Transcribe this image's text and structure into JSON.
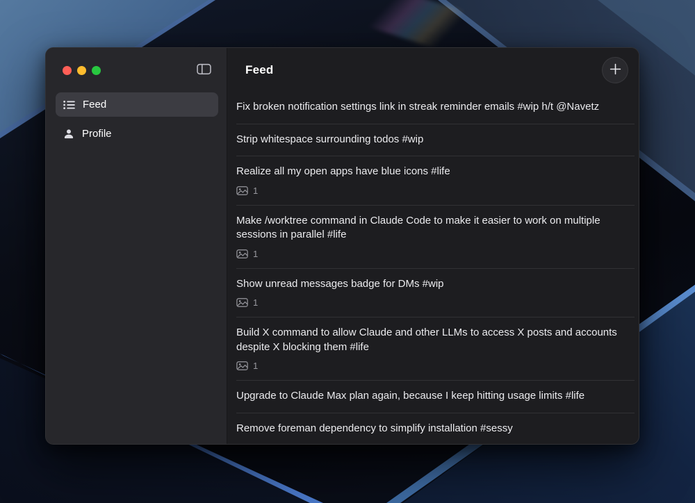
{
  "window": {
    "traffic_lights": {
      "close_color": "#ff5f57",
      "minimize_color": "#febc2e",
      "zoom_color": "#28c840"
    },
    "sidebar": {
      "toggle_icon": "sidebar-toggle-icon",
      "items": [
        {
          "label": "Feed",
          "icon": "list-bullet-icon",
          "selected": true
        },
        {
          "label": "Profile",
          "icon": "person-icon",
          "selected": false
        }
      ]
    },
    "header": {
      "title": "Feed",
      "add_button_icon": "plus-icon"
    },
    "feed": {
      "attachment_icon": "photo-icon",
      "items": [
        {
          "text": "Fix broken notification settings link in streak reminder emails #wip h/t @Navetz"
        },
        {
          "text": "Strip whitespace surrounding todos #wip"
        },
        {
          "text": "Realize all my open apps have blue icons #life",
          "attachment_count": "1"
        },
        {
          "text": "Make /worktree command in Claude Code to make it easier to work on multiple sessions in parallel #life",
          "attachment_count": "1"
        },
        {
          "text": "Show unread messages badge for DMs #wip",
          "attachment_count": "1"
        },
        {
          "text": "Build X command to allow Claude and other LLMs to access X posts and accounts despite X blocking them #life",
          "attachment_count": "1"
        },
        {
          "text": "Upgrade to Claude Max plan again, because I keep hitting usage limits #life"
        },
        {
          "text": "Remove foreman dependency to simplify installation #sessy"
        }
      ]
    }
  }
}
